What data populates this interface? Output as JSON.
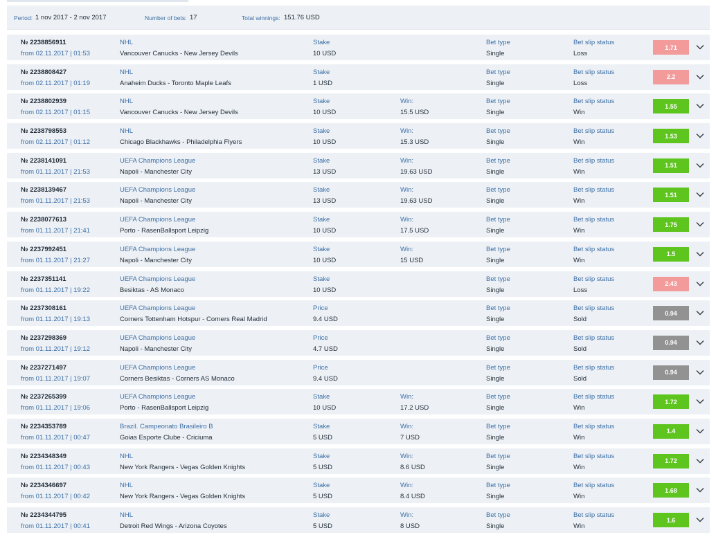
{
  "summary": {
    "period_label": "Period:",
    "period_value": "1 nov 2017 - 2 nov 2017",
    "bets_label": "Number of bets:",
    "bets_value": "17",
    "winnings_label": "Total winnings:",
    "winnings_value": "151.76 USD"
  },
  "labels": {
    "bet_type": "Bet type",
    "status": "Bet slip status",
    "win": "Win:"
  },
  "colors": {
    "Loss": "#f39a9a",
    "Win": "#5ec51e",
    "Sold": "#929292"
  },
  "bets": [
    {
      "id": "№ 2238856911",
      "date": "from 02.11.2017 | 01:53",
      "league": "NHL",
      "match": "Vancouver Canucks - New Jersey Devils",
      "amount_label": "Stake",
      "amount": "10 USD",
      "win": "",
      "bet_type": "Single",
      "status": "Loss",
      "odds": "1.71"
    },
    {
      "id": "№ 2238808427",
      "date": "from 02.11.2017 | 01:19",
      "league": "NHL",
      "match": "Anaheim Ducks - Toronto Maple Leafs",
      "amount_label": "Stake",
      "amount": "1 USD",
      "win": "",
      "bet_type": "Single",
      "status": "Loss",
      "odds": "2.2"
    },
    {
      "id": "№ 2238802939",
      "date": "from 02.11.2017 | 01:15",
      "league": "NHL",
      "match": "Vancouver Canucks - New Jersey Devils",
      "amount_label": "Stake",
      "amount": "10 USD",
      "win": "15.5 USD",
      "bet_type": "Single",
      "status": "Win",
      "odds": "1.55"
    },
    {
      "id": "№ 2238798553",
      "date": "from 02.11.2017 | 01:12",
      "league": "NHL",
      "match": "Chicago Blackhawks - Philadelphia Flyers",
      "amount_label": "Stake",
      "amount": "10 USD",
      "win": "15.3 USD",
      "bet_type": "Single",
      "status": "Win",
      "odds": "1.53"
    },
    {
      "id": "№ 2238141091",
      "date": "from 01.11.2017 | 21:53",
      "league": "UEFA Champions League",
      "match": "Napoli - Manchester City",
      "amount_label": "Stake",
      "amount": "13 USD",
      "win": "19.63 USD",
      "bet_type": "Single",
      "status": "Win",
      "odds": "1.51"
    },
    {
      "id": "№ 2238139467",
      "date": "from 01.11.2017 | 21:53",
      "league": "UEFA Champions League",
      "match": "Napoli - Manchester City",
      "amount_label": "Stake",
      "amount": "13 USD",
      "win": "19.63 USD",
      "bet_type": "Single",
      "status": "Win",
      "odds": "1.51"
    },
    {
      "id": "№ 2238077613",
      "date": "from 01.11.2017 | 21:41",
      "league": "UEFA Champions League",
      "match": "Porto - RasenBallsport Leipzig",
      "amount_label": "Stake",
      "amount": "10 USD",
      "win": "17.5 USD",
      "bet_type": "Single",
      "status": "Win",
      "odds": "1.75"
    },
    {
      "id": "№ 2237992451",
      "date": "from 01.11.2017 | 21:27",
      "league": "UEFA Champions League",
      "match": "Napoli - Manchester City",
      "amount_label": "Stake",
      "amount": "10 USD",
      "win": "15 USD",
      "bet_type": "Single",
      "status": "Win",
      "odds": "1.5"
    },
    {
      "id": "№ 2237351141",
      "date": "from 01.11.2017 | 19:22",
      "league": "UEFA Champions League",
      "match": "Besiktas - AS Monaco",
      "amount_label": "Stake",
      "amount": "10 USD",
      "win": "",
      "bet_type": "Single",
      "status": "Loss",
      "odds": "2.43"
    },
    {
      "id": "№ 2237308161",
      "date": "from 01.11.2017 | 19:13",
      "league": "UEFA Champions League",
      "match": "Corners Tottenham Hotspur - Corners Real Madrid",
      "amount_label": "Price",
      "amount": "9.4 USD",
      "win": "",
      "bet_type": "Single",
      "status": "Sold",
      "odds": "0.94"
    },
    {
      "id": "№ 2237298369",
      "date": "from 01.11.2017 | 19:12",
      "league": "UEFA Champions League",
      "match": "Napoli - Manchester City",
      "amount_label": "Price",
      "amount": "4.7 USD",
      "win": "",
      "bet_type": "Single",
      "status": "Sold",
      "odds": "0.94"
    },
    {
      "id": "№ 2237271497",
      "date": "from 01.11.2017 | 19:07",
      "league": "UEFA Champions League",
      "match": "Corners Besiktas - Corners AS Monaco",
      "amount_label": "Price",
      "amount": "9.4 USD",
      "win": "",
      "bet_type": "Single",
      "status": "Sold",
      "odds": "0.94"
    },
    {
      "id": "№ 2237265399",
      "date": "from 01.11.2017 | 19:06",
      "league": "UEFA Champions League",
      "match": "Porto - RasenBallsport Leipzig",
      "amount_label": "Stake",
      "amount": "10 USD",
      "win": "17.2 USD",
      "bet_type": "Single",
      "status": "Win",
      "odds": "1.72"
    },
    {
      "id": "№ 2234353789",
      "date": "from 01.11.2017 | 00:47",
      "league": "Brazil. Campeonato Brasileiro B",
      "match": "Goias Esporte Clube - Criciuma",
      "amount_label": "Stake",
      "amount": "5 USD",
      "win": "7 USD",
      "bet_type": "Single",
      "status": "Win",
      "odds": "1.4"
    },
    {
      "id": "№ 2234348349",
      "date": "from 01.11.2017 | 00:43",
      "league": "NHL",
      "match": "New York Rangers - Vegas Golden Knights",
      "amount_label": "Stake",
      "amount": "5 USD",
      "win": "8.6 USD",
      "bet_type": "Single",
      "status": "Win",
      "odds": "1.72"
    },
    {
      "id": "№ 2234346697",
      "date": "from 01.11.2017 | 00:42",
      "league": "NHL",
      "match": "New York Rangers - Vegas Golden Knights",
      "amount_label": "Stake",
      "amount": "5 USD",
      "win": "8.4 USD",
      "bet_type": "Single",
      "status": "Win",
      "odds": "1.68"
    },
    {
      "id": "№ 2234344795",
      "date": "from 01.11.2017 | 00:41",
      "league": "NHL",
      "match": "Detroit Red Wings - Arizona Coyotes",
      "amount_label": "Stake",
      "amount": "5 USD",
      "win": "8 USD",
      "bet_type": "Single",
      "status": "Win",
      "odds": "1.6"
    }
  ]
}
